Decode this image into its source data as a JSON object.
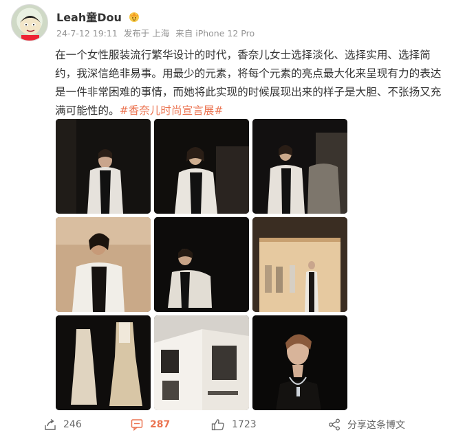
{
  "post": {
    "author": "Leah童Dou",
    "date": "24-7-12 19:11",
    "published_at": "发布于 上海",
    "source": "来自 iPhone 12 Pro",
    "body": "在一个女性服装流行繁华设计的时代，香奈儿女士选择淡化、选择实用、选择简约，我深信绝非易事。用最少的元素，将每个元素的亮点最大化来呈现有力的表达是一件非常困难的事情，而她将此实现的时候展现出来的样子是大胆、不张扬又充满可能性的。",
    "hashtag": "#香奈儿时尚宣言展#"
  },
  "actions": {
    "repost_count": "246",
    "comment_count": "287",
    "like_count": "1723",
    "share_label": "分享这条博文"
  },
  "icons": [
    "avatar-image",
    "vip-badge-icon",
    "repost-icon",
    "comment-icon",
    "like-icon",
    "share-icon"
  ],
  "colors": {
    "accent": "#eb7350",
    "meta": "#939393",
    "text": "#333333"
  }
}
